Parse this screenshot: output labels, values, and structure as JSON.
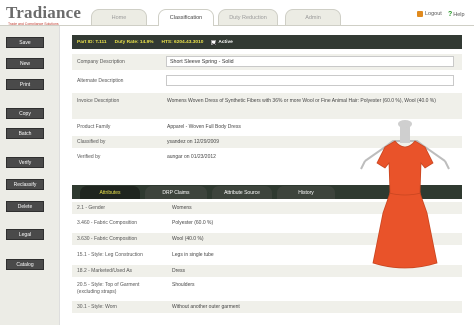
{
  "header": {
    "logo": "Tradiance",
    "logo_tagline": "Trade and Compliance Solutions",
    "tabs": [
      {
        "label": "Home"
      },
      {
        "label": "Classification"
      },
      {
        "label": "Duty Reduction"
      },
      {
        "label": "Admin"
      }
    ],
    "active_tab": "Classification",
    "logout_label": "Logout",
    "help_label": "Help"
  },
  "sidebar": {
    "buttons": [
      "Save",
      "New",
      "Print",
      "Copy",
      "Batch",
      "Verify",
      "Reclassify",
      "Delete",
      "Legal",
      "Catalog"
    ]
  },
  "part_bar": {
    "part_id": "Part ID: T.111",
    "duty_rate": "Duty Rate: 14.9%",
    "hts": "HTS: 6204.43.3010",
    "active_label": "Active",
    "active_checked": true
  },
  "fields": {
    "company_description_label": "Company Description",
    "company_description_value": "Short Sleeve Spring - Solid",
    "alternate_description_label": "Alternate Description",
    "alternate_description_value": "",
    "invoice_description_label": "Invoice Description",
    "invoice_description_value": "Womens Woven Dress of Synthetic Fibers with 36% or more Wool or Fine Animal Hair: Polyester (60.0 %), Wool (40.0 %)",
    "product_family_label": "Product Family",
    "product_family_value": "Apparel - Woven Full Body Dress",
    "classified_by_label": "Classified by",
    "classified_by_value": "ysandez on 12/29/2009",
    "verified_by_label": "Verified by",
    "verified_by_value": "aungar on 01/23/2012"
  },
  "subtabs": [
    "Attributes",
    "DRP Claims",
    "Attribute Source",
    "History"
  ],
  "active_subtab": "Attributes",
  "attributes": [
    {
      "name": "2.1 - Gender",
      "value": "Womens"
    },
    {
      "name": "3.460 - Fabric Composition",
      "value": "Polyester (60.0 %)"
    },
    {
      "name": "3.630 - Fabric Composition",
      "value": "Wool (40.0 %)"
    },
    {
      "name": "15.1 - Style: Leg Construction",
      "value": "Legs in single tube"
    },
    {
      "name": "18.2 - Marketed/Used As",
      "value": "Dress"
    },
    {
      "name": "20.5 - Style: Top of Garment (excluding straps)",
      "value": "Shoulders"
    },
    {
      "name": "30.1 - Style: Worn",
      "value": "Without another outer garment"
    }
  ],
  "colors": {
    "dark_bar": "#323a33",
    "part_bar_text": "#e8e04a",
    "dress": "#e9532a"
  }
}
